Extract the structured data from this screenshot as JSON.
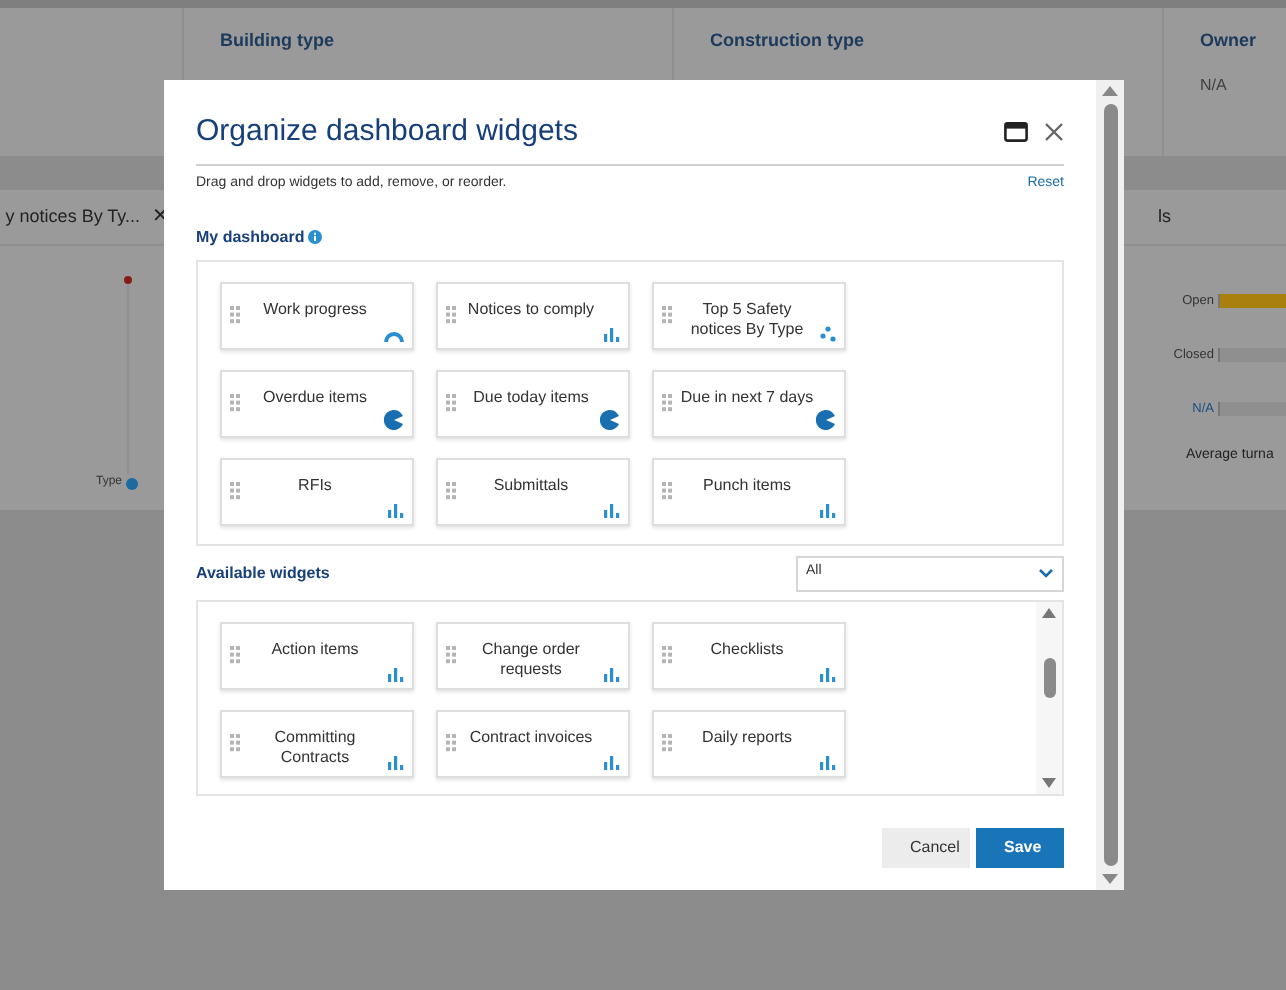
{
  "page": {
    "fields": [
      {
        "label": "Building type"
      },
      {
        "label": "Construction type"
      },
      {
        "label": "Owner",
        "value": "N/A"
      }
    ],
    "left_card": {
      "title": "y notices By Ty...",
      "close": "✕",
      "legend": "Type"
    },
    "right_card": {
      "title": "ls",
      "bars": [
        {
          "label": "Open",
          "kind": "filled"
        },
        {
          "label": "Closed",
          "kind": "empty"
        },
        {
          "label": "N/A",
          "kind": "link"
        }
      ],
      "footer": "Average turna"
    }
  },
  "dialog": {
    "title": "Organize dashboard widgets",
    "instructions": "Drag and drop widgets to add, remove, or reorder.",
    "reset": "Reset",
    "my_dashboard": {
      "heading": "My dashboard",
      "widgets": [
        {
          "name": "Work progress",
          "kind": "gauge"
        },
        {
          "name": "Notices to comply",
          "kind": "bar"
        },
        {
          "name": "Top 5 Safety notices By Type",
          "kind": "scatter"
        },
        {
          "name": "Overdue items",
          "kind": "pie"
        },
        {
          "name": "Due today items",
          "kind": "pie"
        },
        {
          "name": "Due in next 7 days",
          "kind": "pie"
        },
        {
          "name": "RFIs",
          "kind": "bar"
        },
        {
          "name": "Submittals",
          "kind": "bar"
        },
        {
          "name": "Punch items",
          "kind": "bar"
        }
      ]
    },
    "available": {
      "heading": "Available widgets",
      "filter": "All",
      "widgets": [
        {
          "name": "Action items",
          "kind": "bar"
        },
        {
          "name": "Change order requests",
          "kind": "bar"
        },
        {
          "name": "Checklists",
          "kind": "bar"
        },
        {
          "name": "Committing Contracts",
          "kind": "bar"
        },
        {
          "name": "Contract invoices",
          "kind": "bar"
        },
        {
          "name": "Daily reports",
          "kind": "bar"
        }
      ]
    },
    "buttons": [
      {
        "label": "Cancel",
        "kind": "secondary"
      },
      {
        "label": "Save",
        "kind": "primary"
      }
    ]
  }
}
